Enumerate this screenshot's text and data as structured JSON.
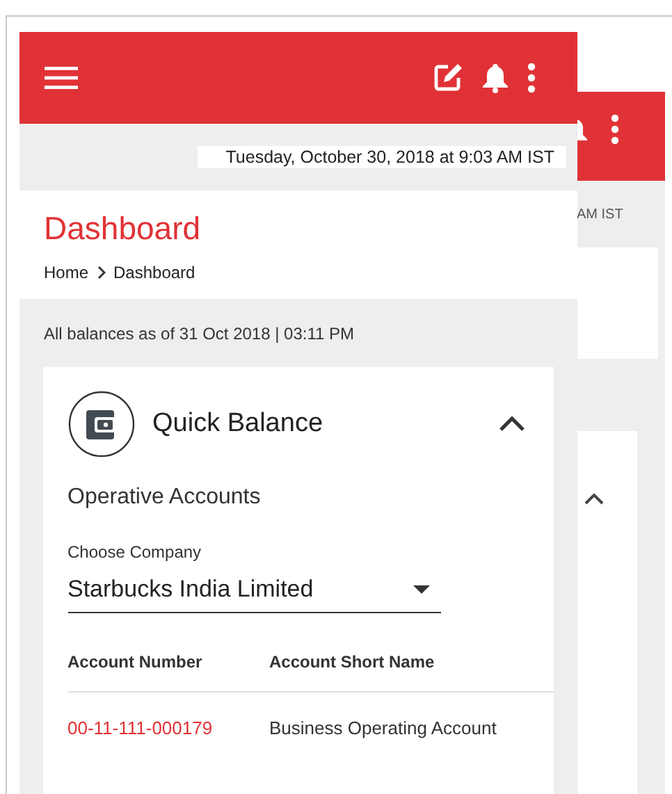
{
  "front_screen": {
    "date_time": "Tuesday, October 30, 2018 at 9:03 AM IST",
    "title": "Dashboard",
    "breadcrumbs": [
      "Home",
      "Dashboard"
    ],
    "balances_note": "All balances as of 31 Oct 2018 | 03:11 PM",
    "quick_balance": {
      "title": "Quick Balance",
      "expanded": true,
      "section": "Operative Accounts",
      "company_field": {
        "label": "Choose Company",
        "value": "Starbucks India Limited"
      },
      "columns": [
        "Account Number",
        "Account Short Name"
      ],
      "rows": [
        {
          "account_number": "00-11-111-000179",
          "short_name": "Business Operating Account"
        }
      ]
    }
  },
  "back_screen": {
    "date_time": "AM IST",
    "quick_balance": {
      "expanded": true
    }
  }
}
